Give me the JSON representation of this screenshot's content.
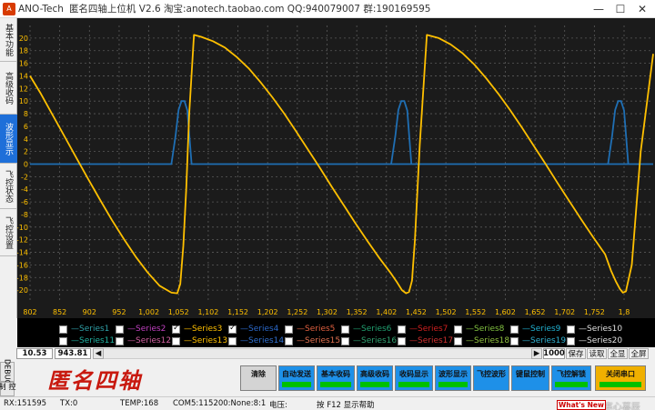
{
  "title_bar": {
    "app_name": "ANO-Tech",
    "text": "匿名四轴上位机   V2.6  淘宝:anotech.taobao.com  QQ:940079007  群:190169595"
  },
  "side_tabs": [
    {
      "label": "基本功能",
      "active": false
    },
    {
      "label": "高级收码",
      "active": false
    },
    {
      "label": "波形显示",
      "active": true
    },
    {
      "label": "飞控状态",
      "active": false
    },
    {
      "label": "飞控设置",
      "active": false
    }
  ],
  "chart_data": {
    "type": "line",
    "y_ticks": [
      20,
      18,
      16,
      14,
      12,
      10,
      8,
      6,
      4,
      2,
      0,
      -2,
      -4,
      -6,
      -8,
      -10,
      -12,
      -14,
      -16,
      -18,
      -20
    ],
    "x_ticks": [
      "802",
      "852",
      "902",
      "952",
      "1,002",
      "1,052",
      "1,102",
      "1,152",
      "1,202",
      "1,252",
      "1,302",
      "1,352",
      "1,402",
      "1,452",
      "1,502",
      "1,552",
      "1,602",
      "1,652",
      "1,702",
      "1,752",
      "1,8"
    ],
    "xlim": [
      802,
      1851
    ],
    "ylim": [
      -22,
      22
    ],
    "grid": true,
    "background": "#1b1b1b",
    "series": [
      {
        "name": "Series3",
        "color": "#ffc000",
        "x": [
          802,
          820,
          840,
          860,
          880,
          900,
          920,
          940,
          960,
          980,
          1000,
          1020,
          1040,
          1050,
          1055,
          1060,
          1065,
          1070,
          1078,
          1090,
          1110,
          1130,
          1150,
          1170,
          1190,
          1210,
          1230,
          1250,
          1270,
          1290,
          1310,
          1330,
          1350,
          1370,
          1390,
          1410,
          1420,
          1428,
          1435,
          1440,
          1445,
          1450,
          1458,
          1470,
          1490,
          1510,
          1530,
          1550,
          1570,
          1590,
          1610,
          1630,
          1650,
          1670,
          1690,
          1710,
          1730,
          1750,
          1770,
          1780,
          1788,
          1795,
          1800,
          1805,
          1815,
          1830,
          1851
        ],
        "y": [
          14.0,
          11.2,
          7.8,
          4.4,
          1.0,
          -2.4,
          -5.7,
          -8.9,
          -11.9,
          -14.7,
          -17.2,
          -19.3,
          -20.4,
          -20.5,
          -19.0,
          -13.0,
          -4.0,
          8.0,
          20.5,
          20.2,
          19.5,
          18.5,
          17.0,
          15.2,
          13.0,
          10.6,
          8.0,
          5.2,
          2.3,
          -0.6,
          -3.6,
          -6.5,
          -9.4,
          -12.2,
          -14.9,
          -17.4,
          -18.8,
          -20.0,
          -20.5,
          -20.3,
          -18.5,
          -12.0,
          3.0,
          20.5,
          20.0,
          19.0,
          17.6,
          15.8,
          13.6,
          11.2,
          8.6,
          5.8,
          2.9,
          0.0,
          -3.0,
          -5.9,
          -8.8,
          -11.6,
          -14.3,
          -16.9,
          -18.6,
          -19.8,
          -20.4,
          -20.2,
          -16.0,
          2.0,
          17.5
        ]
      },
      {
        "name": "Series4",
        "color": "#1f6fb4",
        "x": [
          802,
          1040,
          1047,
          1052,
          1057,
          1062,
          1067,
          1074,
          1851
        ],
        "y": [
          0,
          0,
          4.5,
          8.6,
          10.0,
          10.0,
          8.5,
          0,
          0
        ],
        "x2": [
          1410,
          1417,
          1422,
          1427,
          1432,
          1437,
          1444
        ],
        "y2": [
          0,
          4.5,
          8.6,
          10.0,
          10.0,
          8.5,
          0
        ],
        "x3": [
          1775,
          1782,
          1787,
          1792,
          1797,
          1802,
          1809
        ],
        "y3": [
          0,
          4.5,
          8.6,
          10.0,
          10.0,
          8.5,
          0
        ]
      }
    ]
  },
  "legend": [
    {
      "label": "Series1",
      "color": "#2fa0a8",
      "checked": false
    },
    {
      "label": "Series2",
      "color": "#c040c0",
      "checked": false
    },
    {
      "label": "Series3",
      "color": "#ffc000",
      "checked": true
    },
    {
      "label": "Series4",
      "color": "#2b68c8",
      "checked": true
    },
    {
      "label": "Series5",
      "color": "#e06040",
      "checked": false
    },
    {
      "label": "Series6",
      "color": "#20a070",
      "checked": false
    },
    {
      "label": "Series7",
      "color": "#d02020",
      "checked": false
    },
    {
      "label": "Series8",
      "color": "#80c040",
      "checked": false
    },
    {
      "label": "Series9",
      "color": "#20b0d0",
      "checked": false
    },
    {
      "label": "Series10",
      "color": "#e0e0e0",
      "checked": false
    },
    {
      "label": "Series11",
      "color": "#20b0a0",
      "checked": false
    },
    {
      "label": "Series12",
      "color": "#d060a0",
      "checked": false
    },
    {
      "label": "Series13",
      "color": "#ffc000",
      "checked": false
    },
    {
      "label": "Series14",
      "color": "#3070d0",
      "checked": false
    },
    {
      "label": "Series15",
      "color": "#e07050",
      "checked": false
    },
    {
      "label": "Series16",
      "color": "#30a070",
      "checked": false
    },
    {
      "label": "Series17",
      "color": "#d03030",
      "checked": false
    },
    {
      "label": "Series18",
      "color": "#90c040",
      "checked": false
    },
    {
      "label": "Series19",
      "color": "#30b0d0",
      "checked": false
    },
    {
      "label": "Series20",
      "color": "#e0e0e0",
      "checked": false
    }
  ],
  "controls": {
    "cursor_y": "10.53",
    "cursor_x": "943.81",
    "scroll_left": "◀",
    "scroll_right": "▶",
    "points": "1000",
    "save": "保存",
    "read": "读取",
    "show_all": "全显",
    "fullscreen": "全屏"
  },
  "bottom": {
    "tab_debug": "DEBUG",
    "tab_control": "控制",
    "brand": "匿名四轴",
    "buttons": [
      {
        "label": "清除",
        "bar": false,
        "bg": "#d4d4d4"
      },
      {
        "label": "自动发送",
        "bar": true,
        "bg": "#1e90e8"
      },
      {
        "label": "基本收码",
        "bar": true,
        "bg": "#1e90e8"
      },
      {
        "label": "高级收码",
        "bar": true,
        "bg": "#1e90e8"
      },
      {
        "label": "收码显示",
        "bar": true,
        "bg": "#1e90e8"
      },
      {
        "label": "波形显示",
        "bar": true,
        "bg": "#1e90e8"
      },
      {
        "label": "飞控波形",
        "bar": false,
        "bg": "#1e90e8"
      },
      {
        "label": "键鼠控制",
        "bar": false,
        "bg": "#1e90e8"
      },
      {
        "label": "飞控解锁",
        "bar": true,
        "bg": "#1e90e8"
      },
      {
        "label": "关闭串口",
        "bar": true,
        "bg": "#f0b000"
      }
    ]
  },
  "status": {
    "rx": "RX:151595",
    "tx": "TX:0",
    "temp": "TEMP:168",
    "port": "COM5:115200:None:8:1",
    "voltage": "电压:",
    "help": "按 F12 显示帮助",
    "watermark": "CSDN @步寒心暮辰",
    "whats_new": "What's New"
  }
}
